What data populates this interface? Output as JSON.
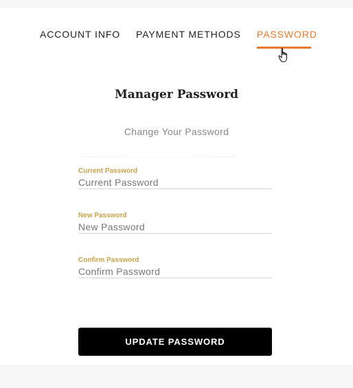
{
  "tabs": [
    {
      "label": "ACCOUNT INFO",
      "active": false
    },
    {
      "label": "PAYMENT METHODS",
      "active": false
    },
    {
      "label": "PASSWORD",
      "active": true
    }
  ],
  "accent_color": "#e87a2f",
  "label_color": "#c7a24a",
  "section": {
    "title": "Manager Password",
    "subtitle": "Change Your Password"
  },
  "form": {
    "current": {
      "label": "Current Password",
      "placeholder": "Current Password"
    },
    "new": {
      "label": "New Password",
      "placeholder": "New Password"
    },
    "confirm": {
      "label": "Confirm Password",
      "placeholder": "Confirm Password"
    },
    "submit_label": "UPDATE PASSWORD"
  },
  "cursor_icon": "hand-pointer-icon"
}
